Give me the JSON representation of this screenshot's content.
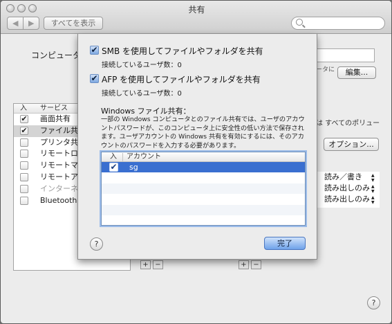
{
  "window": {
    "title": "共有"
  },
  "toolbar": {
    "show_all": "すべてを表示",
    "back": "◀",
    "forward": "▶"
  },
  "background": {
    "computer_name_label": "コンピュータ名",
    "hint_text": "ータに",
    "edit_label": "編集...",
    "policy_text": "は すべてのポリュー",
    "options_label": "オプション...",
    "services_header": {
      "on": "入",
      "service": "サービス"
    },
    "services": [
      {
        "name": "画面共有",
        "checked": true,
        "dim": false,
        "selected": false
      },
      {
        "name": "ファイル共有",
        "checked": true,
        "dim": false,
        "selected": true
      },
      {
        "name": "プリンタ共",
        "checked": false,
        "dim": false,
        "selected": false
      },
      {
        "name": "リモートロ",
        "checked": false,
        "dim": false,
        "selected": false
      },
      {
        "name": "リモートマ",
        "checked": false,
        "dim": false,
        "selected": false
      },
      {
        "name": "リモートアップ",
        "checked": false,
        "dim": false,
        "selected": false
      },
      {
        "name": "インターネット",
        "checked": false,
        "dim": true,
        "selected": false
      },
      {
        "name": "Bluetooth 共",
        "checked": false,
        "dim": false,
        "selected": false
      }
    ],
    "permissions": [
      "読み／書き",
      "読み出しのみ",
      "読み出しのみ"
    ],
    "plus": "+",
    "minus": "−",
    "help": "?"
  },
  "sheet": {
    "smb_label": "SMB を使用してファイルやフォルダを共有",
    "smb_users": "接続しているユーザ数：0",
    "afp_label": "AFP を使用してファイルやフォルダを共有",
    "afp_users": "接続しているユーザ数：0",
    "windows_title": "Windows ファイル共有：",
    "windows_desc": "一部の Windows コンピュータとのファイル共有では、ユーザのアカウントパスワードが、このコンピュータ上に安全性の低い方法で保存されます。ユーザアカウントの Windows 共有を有効にするには、そのアカウントのパスワードを入力する必要があります。",
    "table_header": {
      "on": "入",
      "account": "アカウント"
    },
    "accounts": [
      {
        "name": "sg",
        "checked": true,
        "selected": true
      }
    ],
    "empty_rows": 5,
    "help": "?",
    "done_label": "完了"
  },
  "colors": {
    "selection": "#3a6fd0",
    "accent": "#6fa2ea"
  }
}
